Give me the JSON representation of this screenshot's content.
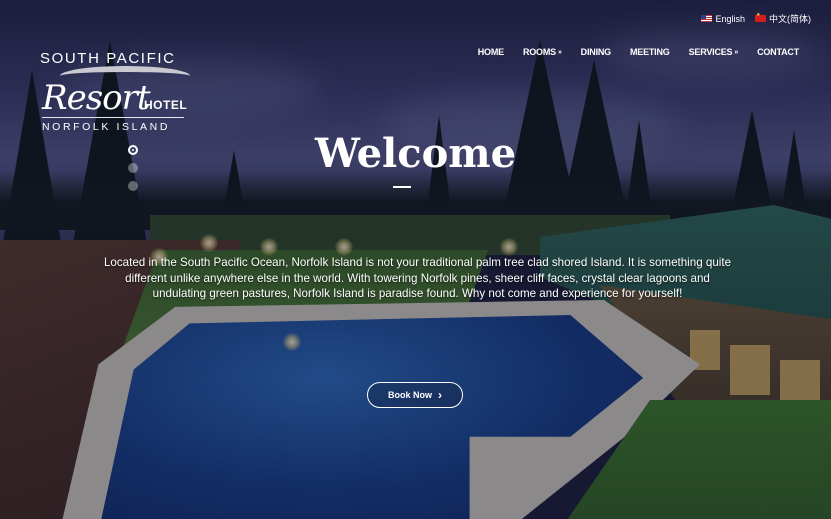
{
  "logo": {
    "line1": "SOUTH PACIFIC",
    "line2": "Resort",
    "line3": "HOTEL",
    "line4": "NORFOLK ISLAND"
  },
  "language": [
    {
      "label": "English",
      "flag": "us-flag-icon"
    },
    {
      "label": "中文(简体)",
      "flag": "cn-flag-icon"
    }
  ],
  "nav": {
    "home": "HOME",
    "rooms": "ROOMS",
    "dining": "DINING",
    "meeting": "MEETING",
    "services": "SERVICES",
    "contact": "CONTACT"
  },
  "hero": {
    "title": "Welcome",
    "intro": "Located in the South Pacific Ocean, Norfolk Island is not your traditional palm tree clad shored Island. It is something quite different unlike anywhere else in the world. With towering Norfolk pines, sheer cliff faces, crystal clear lagoons and undulating green pastures, Norfolk Island is paradise found. Why not come and experience for yourself!",
    "button": "Book Now"
  },
  "slider": {
    "count": 3,
    "active": 1
  },
  "colors": {
    "overlay": "#12122a",
    "text": "#ffffff"
  }
}
